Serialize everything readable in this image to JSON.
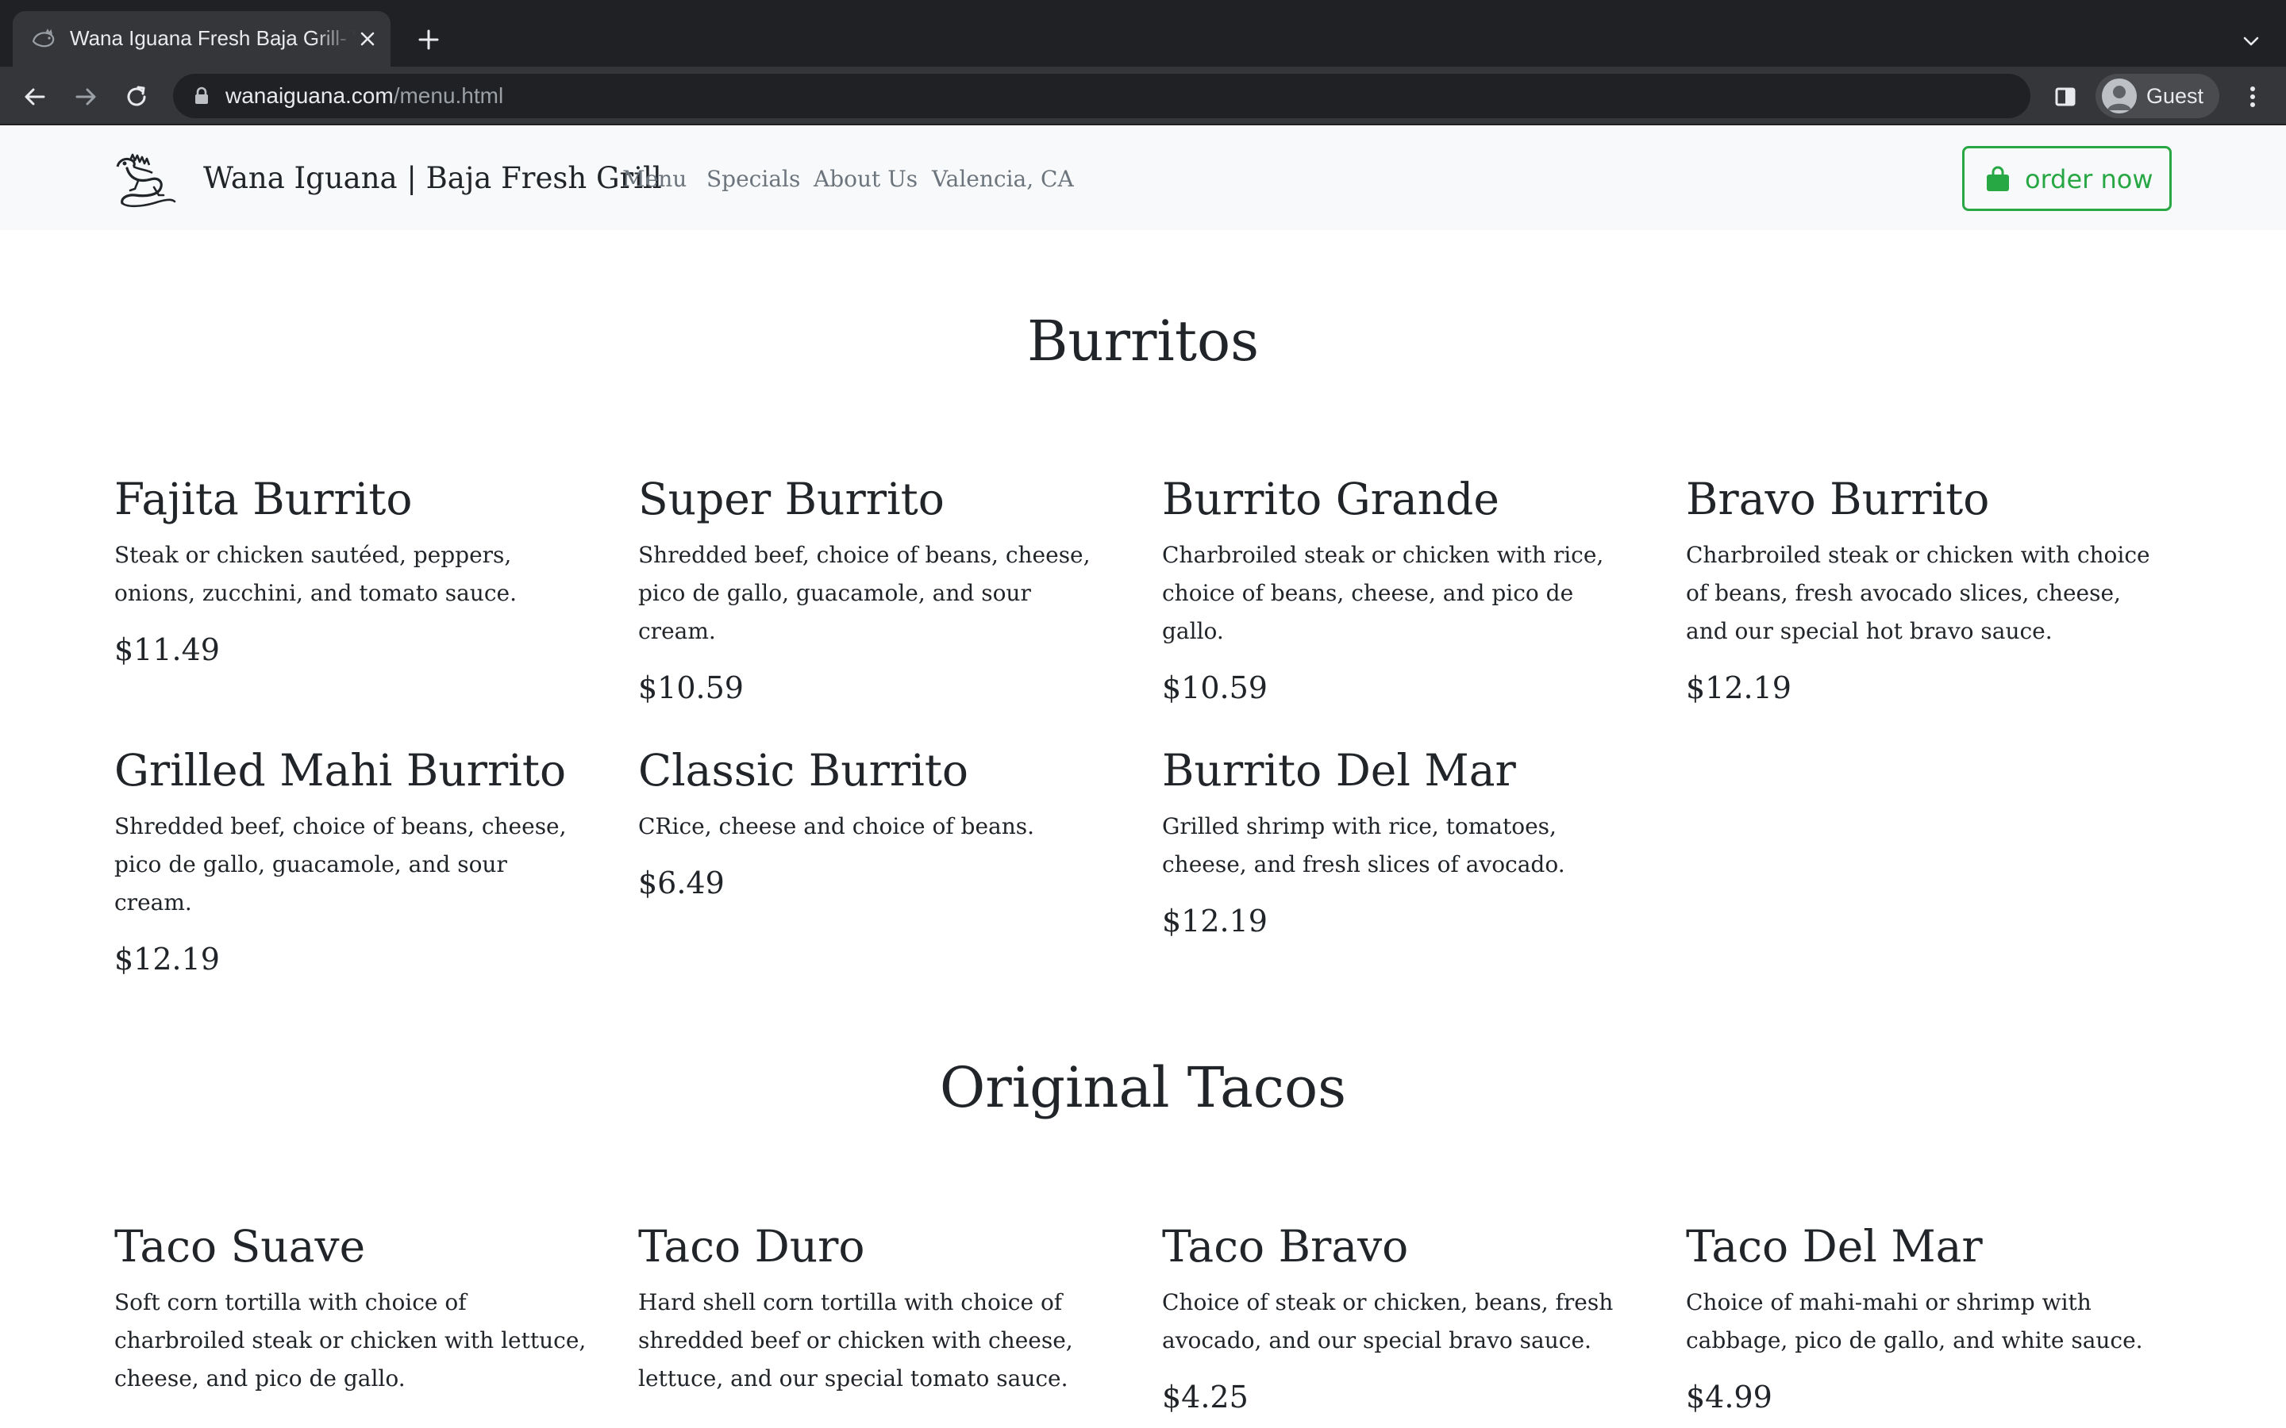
{
  "browser": {
    "tab_title": "Wana Iguana Fresh Baja Grill- Valencia, CA",
    "url_host": "wanaiguana.com",
    "url_path": "/menu.html",
    "profile_label": "Guest"
  },
  "navbar": {
    "brand": "Wana Iguana | Baja Fresh Grill",
    "links": [
      "Menu",
      "Specials",
      "About Us",
      "Valencia, CA"
    ],
    "order_button": "order now",
    "accent_color": "#28a745"
  },
  "sections": [
    {
      "title": "Burritos",
      "items": [
        {
          "name": "Fajita Burrito",
          "desc": "Steak or chicken sautéed, peppers, onions, zucchini, and tomato sauce.",
          "price": "$11.49"
        },
        {
          "name": "Super Burrito",
          "desc": "Shredded beef, choice of beans, cheese, pico de gallo, guacamole, and sour cream.",
          "price": "$10.59"
        },
        {
          "name": "Burrito Grande",
          "desc": "Charbroiled steak or chicken with rice, choice of beans, cheese, and pico de gallo.",
          "price": "$10.59"
        },
        {
          "name": "Bravo Burrito",
          "desc": "Charbroiled steak or chicken with choice of beans, fresh avocado slices, cheese, and our special hot bravo sauce.",
          "price": "$12.19"
        },
        {
          "name": "Grilled Mahi Burrito",
          "desc": "Shredded beef, choice of beans, cheese, pico de gallo, guacamole, and sour cream.",
          "price": "$12.19"
        },
        {
          "name": "Classic Burrito",
          "desc": "CRice, cheese and choice of beans.",
          "price": "$6.49"
        },
        {
          "name": "Burrito Del Mar",
          "desc": "Grilled shrimp with rice, tomatoes, cheese, and fresh slices of avocado.",
          "price": "$12.19"
        }
      ]
    },
    {
      "title": "Original Tacos",
      "items": [
        {
          "name": "Taco Suave",
          "desc": "Soft corn tortilla with choice of charbroiled steak or chicken with lettuce, cheese, and pico de gallo.",
          "price": ""
        },
        {
          "name": "Taco Duro",
          "desc": "Hard shell corn tortilla with choice of shredded beef or chicken with cheese, lettuce, and our special tomato sauce.",
          "price": ""
        },
        {
          "name": "Taco Bravo",
          "desc": "Choice of steak or chicken, beans, fresh avocado, and our special bravo sauce.",
          "price": "$4.25"
        },
        {
          "name": "Taco Del Mar",
          "desc": "Choice of mahi-mahi or shrimp with cabbage, pico de gallo, and white sauce.",
          "price": "$4.99"
        }
      ]
    }
  ]
}
